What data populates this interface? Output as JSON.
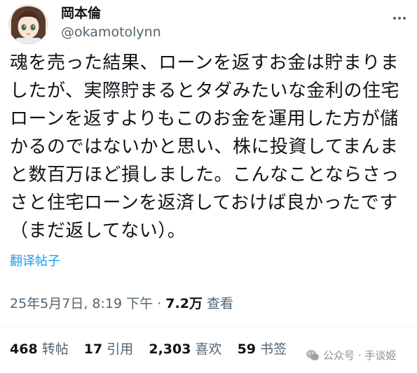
{
  "user": {
    "display_name": "岡本倫",
    "handle": "@okamotolynn"
  },
  "icons": {
    "avatar": "anime-girl-avatar",
    "more": "more-dots-icon",
    "watermark": "wechat-icon"
  },
  "tweet": {
    "text": "魂を売った結果、ローンを返すお金は貯まりましたが、実際貯まるとタダみたいな金利の住宅ローンを返すよりもこのお金を運用した方が儲かるのではないかと思い、株に投資してまんまと数百万ほど損しました。こんなことならさっさと住宅ローンを返済しておけば良かったです（まだ返してない）。",
    "translate_label": "翻译帖子"
  },
  "meta": {
    "timestamp": "25年5月7日, 8:19 下午",
    "separator": "·",
    "views_count": "7.2万",
    "views_label": "查看"
  },
  "stats": {
    "reposts": {
      "count": "468",
      "label": "转帖"
    },
    "quotes": {
      "count": "17",
      "label": "引用"
    },
    "likes": {
      "count": "2,303",
      "label": "喜欢"
    },
    "bookmarks": {
      "count": "59",
      "label": "书签"
    }
  },
  "watermark": {
    "text": "公众号 · 手谈姬"
  },
  "colors": {
    "link": "#1d9bf0",
    "muted": "#536471",
    "text": "#0f1419"
  }
}
